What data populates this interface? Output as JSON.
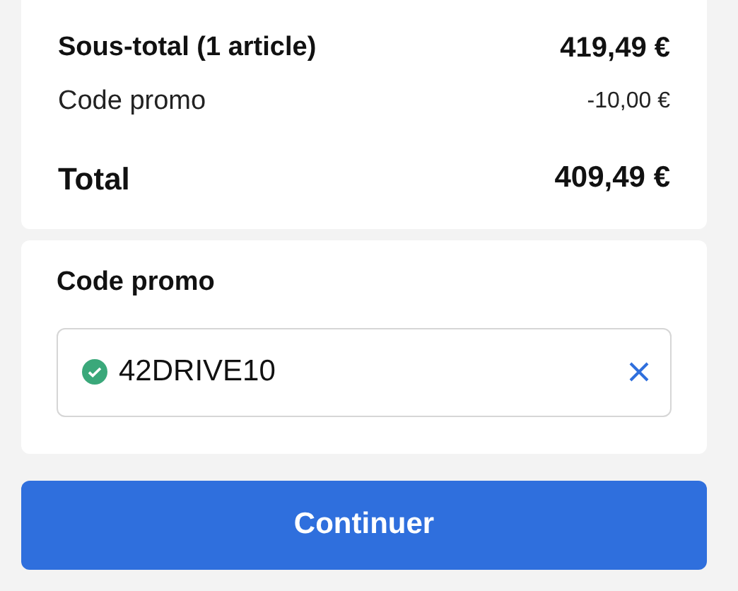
{
  "summary": {
    "rows": [
      {
        "kind": "subtotal",
        "label": "Sous-total (1 article)",
        "value": "419,49 €"
      },
      {
        "kind": "discount",
        "label": "Code promo",
        "value": "-10,00 €"
      },
      {
        "kind": "total",
        "label": "Total",
        "value": "409,49 €"
      }
    ]
  },
  "promo": {
    "title": "Code promo",
    "value": "42DRIVE10",
    "valid": true
  },
  "button": {
    "label": "Continuer"
  }
}
